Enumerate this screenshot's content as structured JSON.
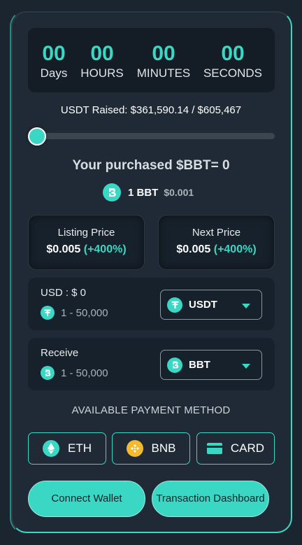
{
  "countdown": {
    "days": {
      "value": "00",
      "label": "Days"
    },
    "hours": {
      "value": "00",
      "label": "HOURS"
    },
    "minutes": {
      "value": "00",
      "label": "MINUTES"
    },
    "seconds": {
      "value": "00",
      "label": "SECONDS"
    }
  },
  "raised": {
    "text": "USDT Raised: $361,590.14 / $605,467",
    "progress_fraction": 0.0
  },
  "purchased": "Your purchased $BBT= 0",
  "rate": {
    "bbt": "1 BBT",
    "usd": "$0.001"
  },
  "prices": {
    "listing": {
      "label": "Listing Price",
      "value": "$0.005",
      "pct": "(+400%)"
    },
    "next": {
      "label": "Next Price",
      "value": "$0.005",
      "pct": "(+400%)"
    }
  },
  "pay": {
    "label": "USD : $ 0",
    "range": "1 - 50,000",
    "currency": "USDT",
    "icon": "tether-icon"
  },
  "receive": {
    "label": "Receive",
    "range": "1 - 50,000",
    "currency": "BBT",
    "icon": "bbt-icon"
  },
  "payment_methods": {
    "title": "AVAILABLE PAYMENT METHOD",
    "items": [
      {
        "label": "ETH",
        "icon": "ethereum-icon"
      },
      {
        "label": "BNB",
        "icon": "bnb-icon"
      },
      {
        "label": "CARD",
        "icon": "card-icon"
      }
    ]
  },
  "actions": {
    "connect": "Connect Wallet",
    "dashboard": "Transaction Dashboard"
  },
  "colors": {
    "accent": "#3ad7c4",
    "background": "#1f2a36",
    "panel": "#17212b",
    "bnb": "#f3ba2f"
  }
}
